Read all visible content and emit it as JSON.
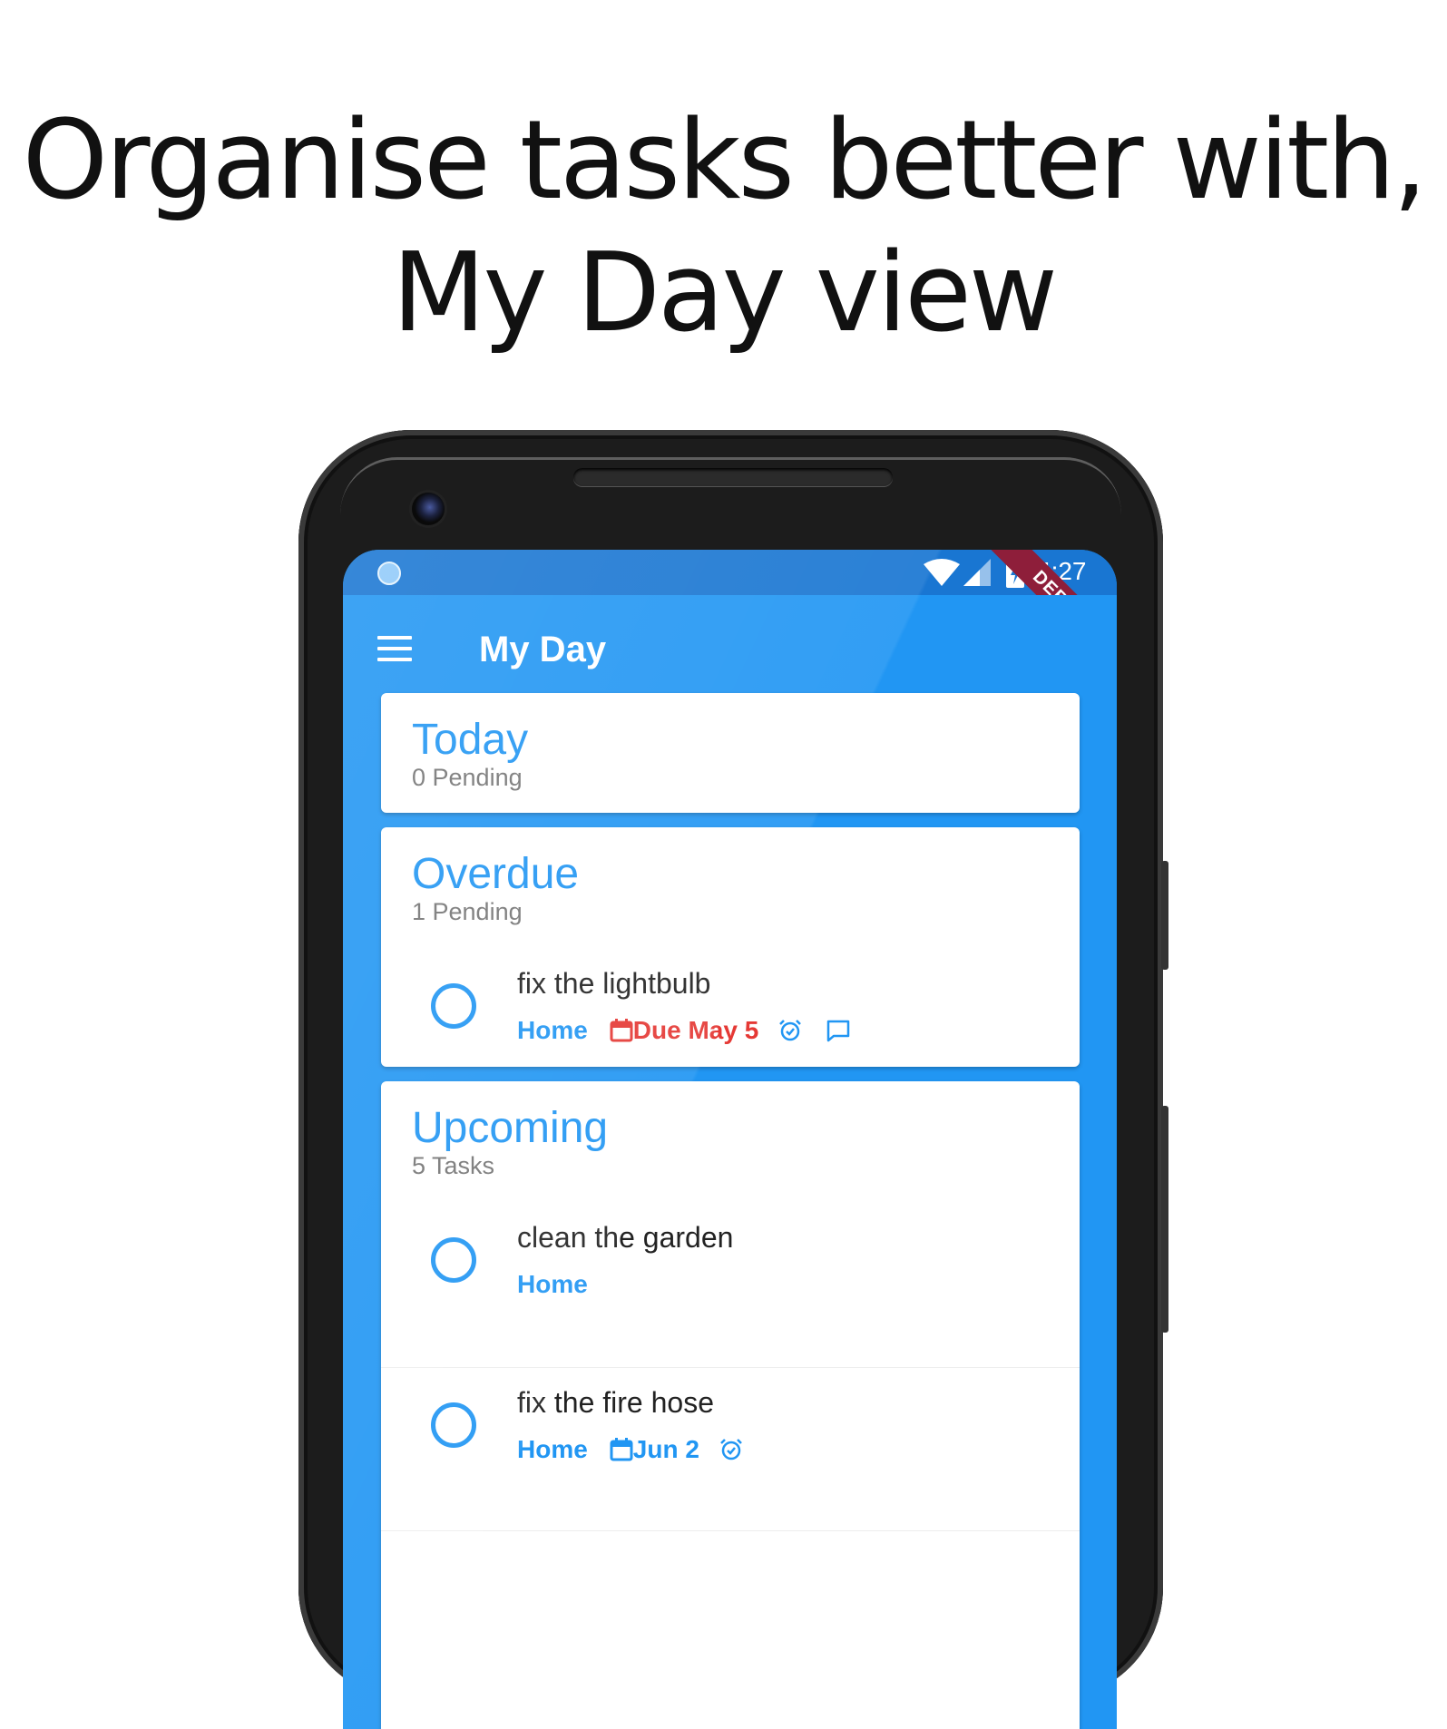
{
  "headline": {
    "line1": "Organise tasks better with,",
    "line2": "My Day view"
  },
  "statusbar": {
    "time": "4:27",
    "debug_banner": "DEBUG"
  },
  "appbar": {
    "title": "My Day"
  },
  "sections": [
    {
      "title": "Today",
      "subtitle": "0 Pending",
      "tasks": []
    },
    {
      "title": "Overdue",
      "subtitle": "1 Pending",
      "tasks": [
        {
          "title": "fix the lightbulb",
          "project": "Home",
          "due": "Due May 5",
          "due_status": "overdue",
          "has_reminder": true,
          "has_comment": true
        }
      ]
    },
    {
      "title": "Upcoming",
      "subtitle": "5 Tasks",
      "tasks": [
        {
          "title": "clean the garden",
          "project": "Home"
        },
        {
          "title": "fix the fire hose",
          "project": "Home",
          "due": "Jun 2",
          "due_status": "normal",
          "has_reminder": true
        }
      ]
    }
  ],
  "colors": {
    "primary": "#2196F3",
    "primary_dark": "#1976D2",
    "overdue": "#E53935",
    "debug_ribbon": "#8E1E3A"
  },
  "icons": {
    "menu": "hamburger-icon",
    "calendar": "calendar-icon",
    "reminder": "alarm-icon",
    "comment": "comment-icon"
  }
}
